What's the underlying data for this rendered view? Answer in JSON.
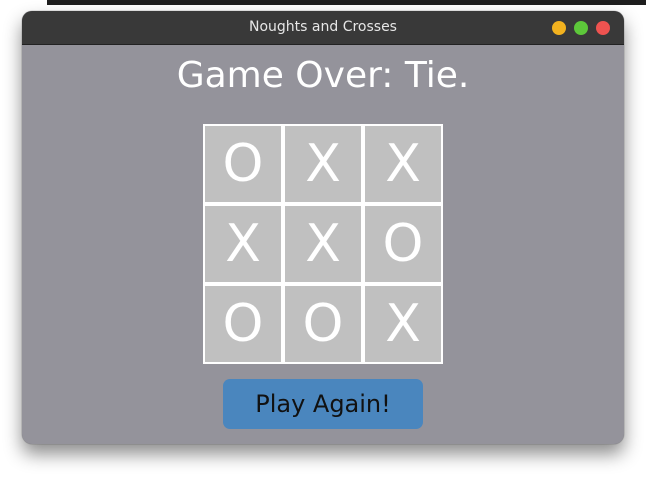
{
  "window": {
    "title": "Noughts and Crosses"
  },
  "game": {
    "status": "Game Over: Tie.",
    "board": [
      [
        "O",
        "X",
        "X"
      ],
      [
        "X",
        "X",
        "O"
      ],
      [
        "O",
        "O",
        "X"
      ]
    ]
  },
  "controls": {
    "play_again_label": "Play Again!"
  },
  "colors": {
    "window_background": "#94939b",
    "titlebar": "#393939",
    "cell_background": "#c0c0c0",
    "grid_lines": "#ffffff",
    "button_background": "#4a86be",
    "traffic_minimize": "#f2b21f",
    "traffic_maximize": "#5dc73a",
    "traffic_close": "#ee5350"
  }
}
